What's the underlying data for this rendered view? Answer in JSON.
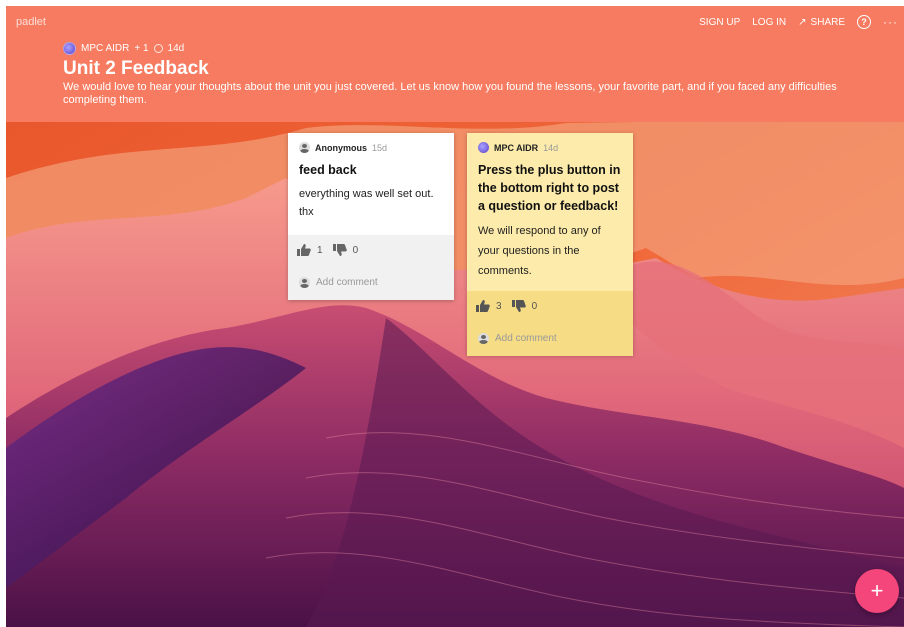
{
  "brand": "padlet",
  "nav": {
    "signup": "SIGN UP",
    "login": "LOG IN",
    "share": "SHARE",
    "help_icon": "help-icon",
    "more_icon": "more-icon"
  },
  "board": {
    "owner": "MPC AIDR",
    "collaborators": "+ 1",
    "age": "14d",
    "title": "Unit 2 Feedback",
    "description": "We would love to hear your thoughts about the unit you just covered. Let us know how you found the lessons, your favorite part, and if you faced any difficulties completing them."
  },
  "posts": [
    {
      "author": "Anonymous",
      "age": "15d",
      "title": "feed back",
      "body": "everything was well set out. thx",
      "likes": "1",
      "dislikes": "0",
      "add_comment": "Add comment",
      "color": "#ffffff"
    },
    {
      "author": "MPC AIDR",
      "age": "14d",
      "title": "Press the plus button in the bottom right to post a question or feedback!",
      "body": "We will respond to any of your questions in the comments.",
      "likes": "3",
      "dislikes": "0",
      "add_comment": "Add comment",
      "color": "#fcebaa"
    }
  ],
  "fab_label": "+",
  "colors": {
    "header": "#f67b60",
    "fab": "#f4467b"
  }
}
